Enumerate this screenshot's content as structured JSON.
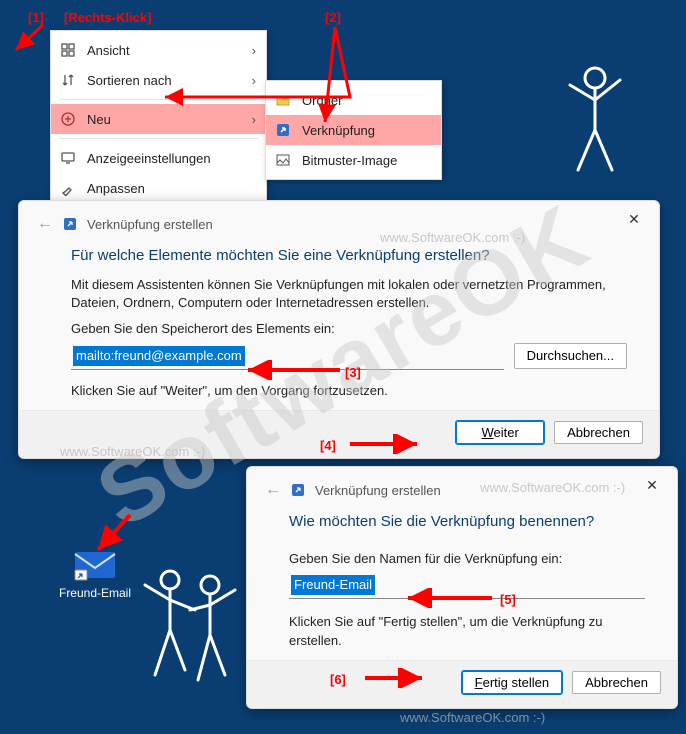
{
  "annotations": {
    "a1": "[1]",
    "a1b": "[Rechts-Klick]",
    "a2": "[2]",
    "a3": "[3]",
    "a4": "[4]",
    "a5": "[5]",
    "a6": "[6]"
  },
  "menu1": {
    "ansicht": "Ansicht",
    "sortieren": "Sortieren nach",
    "neu": "Neu",
    "anzeige": "Anzeigeeinstellungen",
    "anpassen": "Anpassen"
  },
  "menu2": {
    "ordner": "Ordner",
    "verknuepfung": "Verknüpfung",
    "bitmuster": "Bitmuster-Image"
  },
  "wizard1": {
    "crumb": "Verknüpfung erstellen",
    "heading": "Für welche Elemente möchten Sie eine Verknüpfung erstellen?",
    "intro": "Mit diesem Assistenten können Sie Verknüpfungen mit lokalen oder vernetzten Programmen, Dateien, Ordnern, Computern oder Internetadressen erstellen.",
    "field_label": "Geben Sie den Speicherort des Elements ein:",
    "value": "mailto:freund@example.com",
    "browse": "Durchsuchen...",
    "hint": "Klicken Sie auf \"Weiter\", um den Vorgang fortzusetzen.",
    "next": "Weiter",
    "cancel": "Abbrechen"
  },
  "wizard2": {
    "crumb": "Verknüpfung erstellen",
    "heading": "Wie möchten Sie die Verknüpfung benennen?",
    "field_label": "Geben Sie den Namen für die Verknüpfung ein:",
    "value": "Freund-Email",
    "hint": "Klicken Sie auf \"Fertig stellen\", um die Verknüpfung zu erstellen.",
    "finish": "Fertig stellen",
    "cancel": "Abbrechen"
  },
  "desktop_icon": {
    "label": "Freund-Email"
  },
  "watermark": {
    "big": "SoftwareOK",
    "line": "www.SoftwareOK.com  :-)"
  }
}
